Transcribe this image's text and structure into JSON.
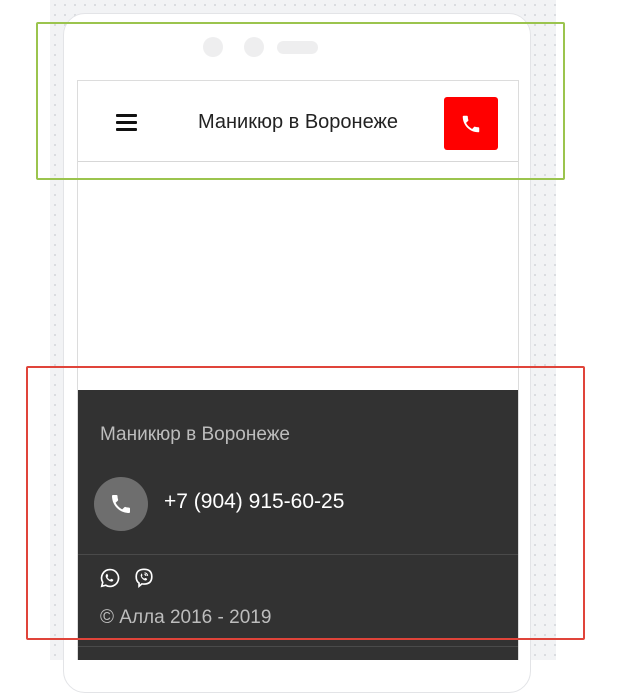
{
  "header": {
    "title": "Маникюр в Воронеже",
    "menu_icon": "hamburger-menu-icon",
    "call_icon": "phone-icon",
    "call_button_color": "#ff0000"
  },
  "footer": {
    "title": "Маникюр в Воронеже",
    "phone": "+7 (904) 915-60-25",
    "phone_icon": "phone-icon",
    "social": [
      "whatsapp-icon",
      "viber-icon"
    ],
    "copyright": "© Алла 2016 - 2019",
    "background": "#323232"
  },
  "annotations": {
    "header_box_color": "#9bc44e",
    "footer_box_color": "#e0443a"
  }
}
